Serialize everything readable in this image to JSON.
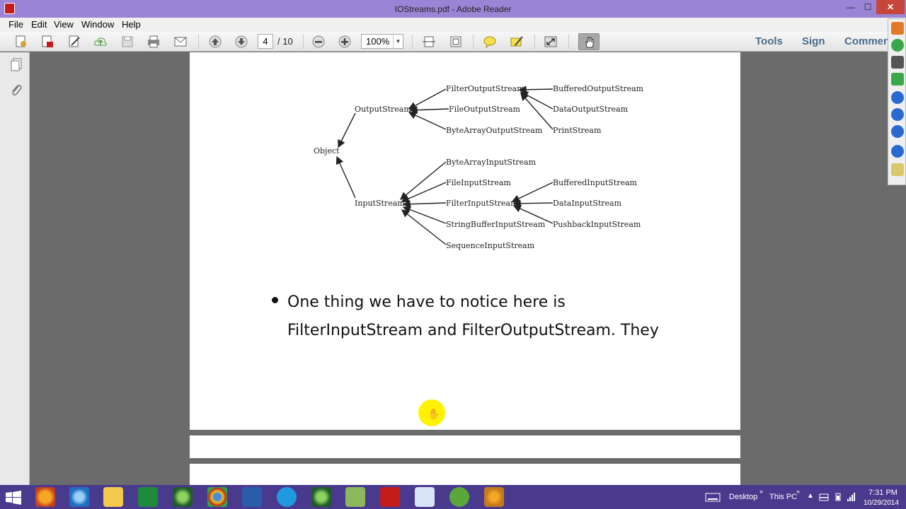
{
  "window": {
    "title": "IOStreams.pdf - Adobe Reader",
    "min_label": "—",
    "max_label": "☐",
    "close_label": "✕"
  },
  "menu": {
    "file": "File",
    "edit": "Edit",
    "view": "View",
    "window": "Window",
    "help": "Help"
  },
  "toolbar": {
    "page_current": "4",
    "page_total": "/ 10",
    "zoom": "100%",
    "tools": "Tools",
    "sign": "Sign",
    "comment": "Commen"
  },
  "diagram": {
    "object": "Object",
    "output_stream": "OutputStream",
    "input_stream": "InputStream",
    "filter_output_stream": "FilterOutputStream",
    "file_output_stream": "FileOutputStream",
    "byte_array_output_stream": "ByteArrayOutputStream",
    "buffered_output_stream": "BufferedOutputStream",
    "data_output_stream": "DataOutputStream",
    "print_stream": "PrintStream",
    "byte_array_input_stream": "ByteArrayInputStream",
    "file_input_stream": "FileInputStream",
    "filter_input_stream": "FilterInputStream",
    "string_buffer_input_stream": "StringBufferInputStream",
    "sequence_input_stream": "SequenceInputStream",
    "buffered_input_stream": "BufferedInputStream",
    "data_input_stream": "DataInputStream",
    "pushback_input_stream": "PushbackInputStream"
  },
  "bullet": {
    "line1": "One thing we have to notice here is",
    "line2": "FilterInputStream and FilterOutputStream. They"
  },
  "taskbar": {
    "desktop": "Desktop",
    "this_pc": "This PC",
    "time": "7:31 PM",
    "date": "10/29/2014"
  },
  "colors": {
    "titlebar": "#9a84d6",
    "taskbar": "#4a3a8e",
    "cursor_highlight": "#fff200"
  }
}
